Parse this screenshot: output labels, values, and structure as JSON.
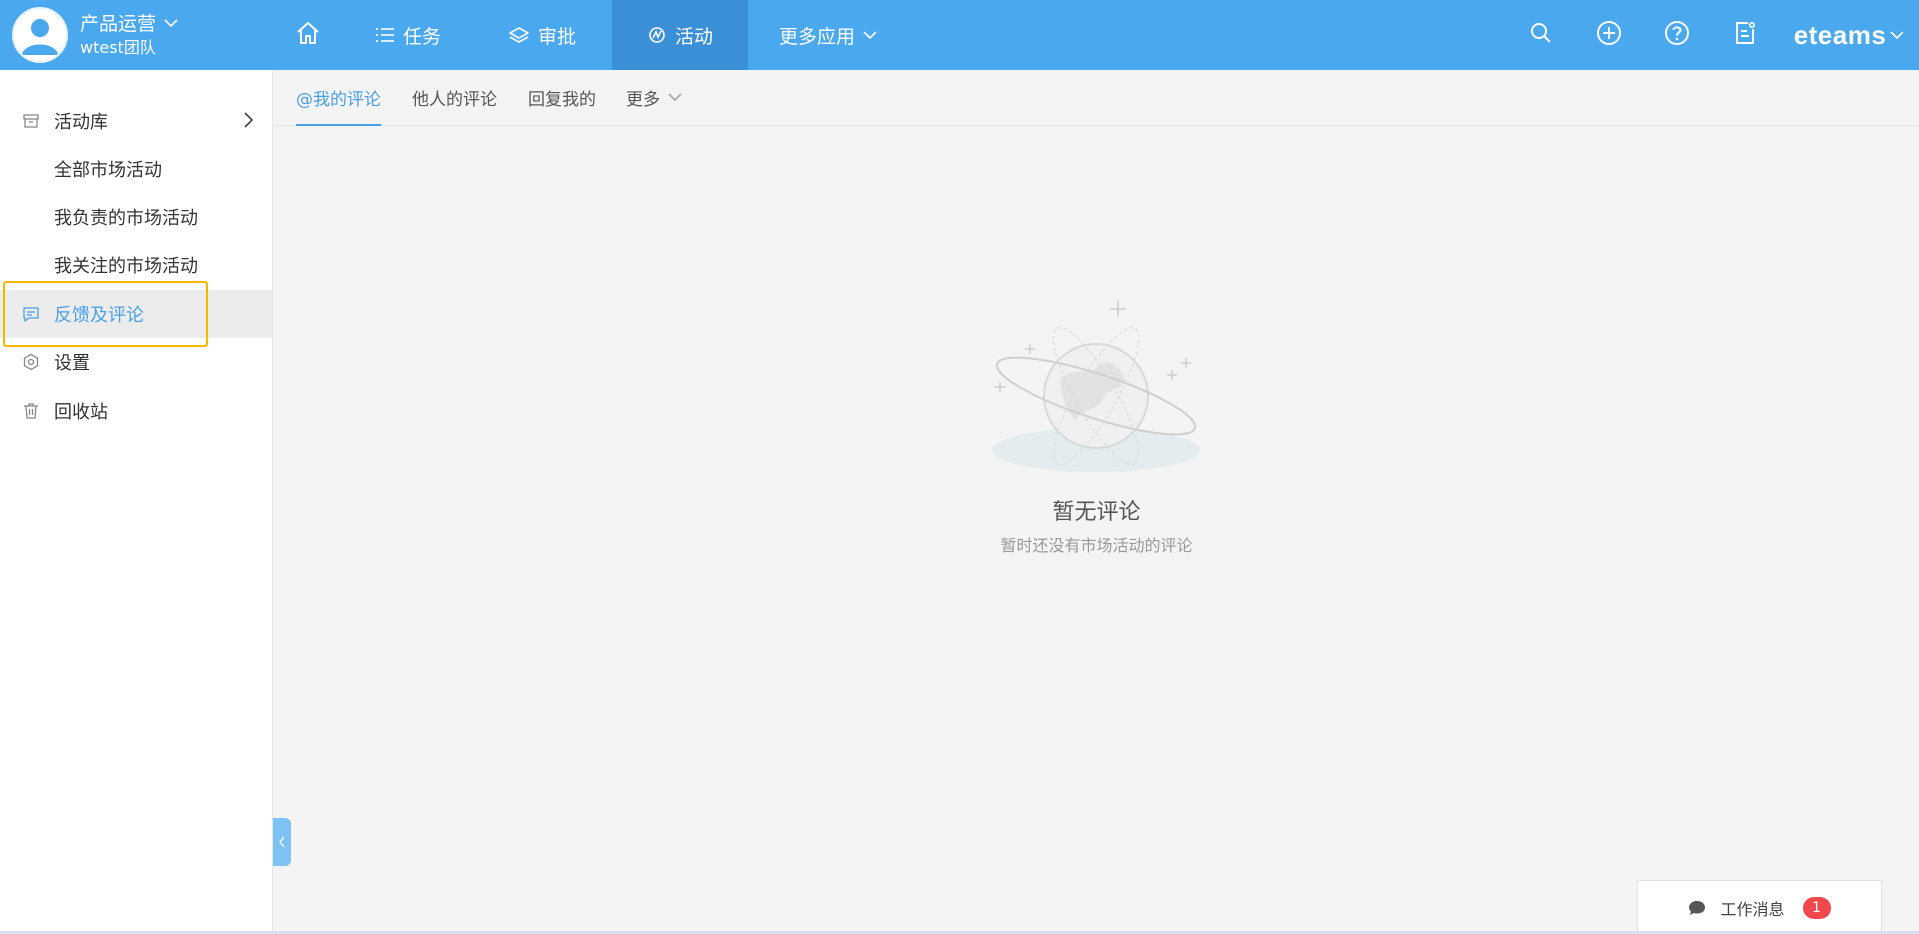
{
  "header": {
    "team_name": "产品运营",
    "team_sub": "wtest团队",
    "nav": {
      "home_icon": "home-icon",
      "task_label": "任务",
      "approve_label": "审批",
      "activity_label": "活动",
      "more_label": "更多应用"
    },
    "brand": "eteams",
    "colors": {
      "bar": "#4aa8ef",
      "active": "#3a8fd6"
    }
  },
  "sidebar": {
    "items": [
      {
        "label": "活动库",
        "icon": "archive-box-icon"
      },
      {
        "label": "全部市场活动"
      },
      {
        "label": "我负责的市场活动"
      },
      {
        "label": "我关注的市场活动"
      },
      {
        "label": "反馈及评论",
        "icon": "comment-icon",
        "active": true
      },
      {
        "label": "设置",
        "icon": "settings-hex-icon"
      },
      {
        "label": "回收站",
        "icon": "trash-icon"
      }
    ]
  },
  "tabs": {
    "mine": "@我的评论",
    "others": "他人的评论",
    "replies": "回复我的",
    "more": "更多"
  },
  "empty_state": {
    "icon": "planet-empty-illustration",
    "title": "暂无评论",
    "subtitle": "暂时还没有市场活动的评论"
  },
  "messages": {
    "label": "工作消息",
    "count": "1",
    "icon": "chat-bubble-icon"
  }
}
